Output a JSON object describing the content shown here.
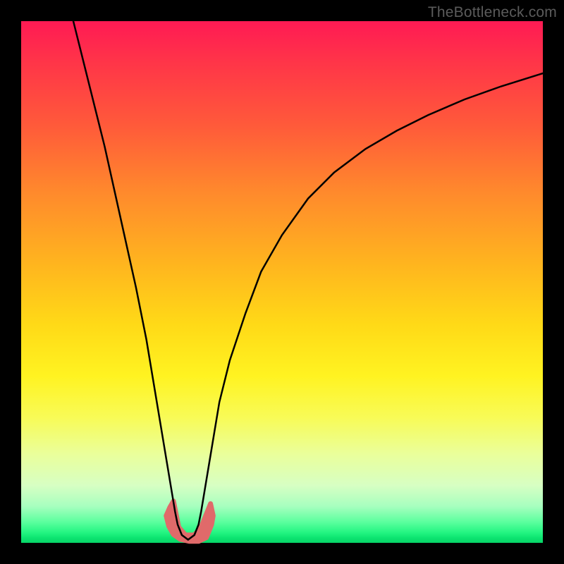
{
  "watermark": "TheBottleneck.com",
  "chart_data": {
    "type": "line",
    "title": "",
    "xlabel": "",
    "ylabel": "",
    "xlim": [
      0,
      100
    ],
    "ylim": [
      0,
      100
    ],
    "gradient_bg": {
      "top_color": "#ff1a54",
      "bottom_color": "#07d467",
      "orientation": "vertical"
    },
    "series": [
      {
        "name": "main-curve",
        "color": "#000000",
        "stroke_width": 2.5,
        "x": [
          10,
          12,
          14,
          16,
          18,
          20,
          22,
          24,
          25,
          26,
          27,
          28,
          29,
          29.5,
          30,
          30.8,
          32,
          33.2,
          34,
          34.5,
          35,
          36,
          37,
          38,
          40,
          43,
          46,
          50,
          55,
          60,
          66,
          72,
          78,
          85,
          92,
          100
        ],
        "y": [
          100,
          92,
          84,
          76,
          67,
          58,
          49,
          39,
          33,
          27,
          21,
          15,
          9,
          6,
          3.5,
          1.5,
          0.6,
          1.5,
          3.5,
          6,
          9,
          15,
          21,
          27,
          35,
          44,
          52,
          59,
          66,
          71,
          75.5,
          79,
          82,
          85,
          87.5,
          90
        ]
      },
      {
        "name": "red-blob",
        "color": "#e06a6a",
        "type": "area",
        "x": [
          27.8,
          28.5,
          29.2,
          30.2,
          31.5,
          33.2,
          34.5,
          35.5,
          36.3,
          36.8,
          36.5,
          35.5,
          34.0,
          32.2,
          30.5,
          29.2,
          28.3,
          27.8
        ],
        "y": [
          5.2,
          6.8,
          8.0,
          3.0,
          1.5,
          1.5,
          3.0,
          5.5,
          7.5,
          5.2,
          3.5,
          1.0,
          0.3,
          0.3,
          0.7,
          1.6,
          3.2,
          5.2
        ]
      }
    ]
  }
}
